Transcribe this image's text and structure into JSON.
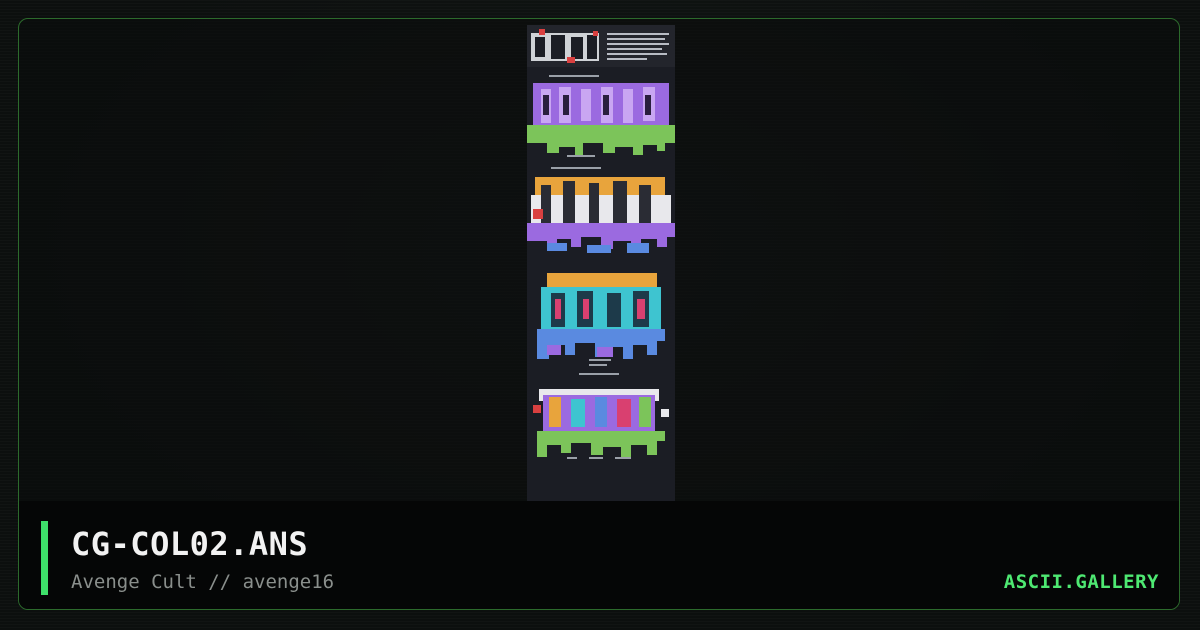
{
  "artwork": {
    "filename": "CG-COL02.ANS",
    "group": "Avenge Cult",
    "separator": "//",
    "author": "avenge16",
    "byline": "Avenge Cult // avenge16"
  },
  "site": {
    "brand": "ASCII.GALLERY"
  },
  "colors": {
    "accent": "#3ee06a",
    "brand": "#4ee872",
    "frame_border": "#2c6a2c",
    "background": "#0c0f0e",
    "footer": "#050606"
  },
  "art_thumbnail": {
    "sections": [
      "block-letters-white-red",
      "block-letters-purple-green",
      "block-letters-orange-white-purple",
      "block-letters-cyan-blue",
      "block-letters-multicolor"
    ]
  }
}
